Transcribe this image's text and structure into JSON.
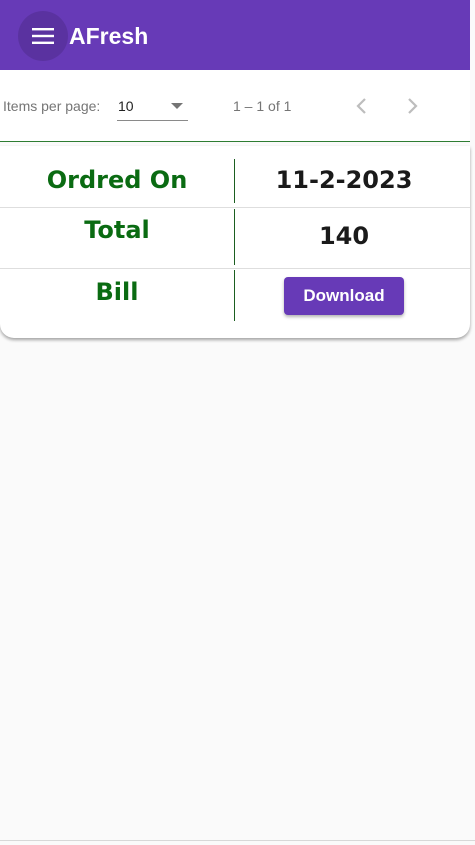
{
  "toolbar": {
    "app_title": "AFresh",
    "menu_icon": "menu-icon",
    "color": "#673ab7"
  },
  "paginator": {
    "items_per_page_label": "Items per page:",
    "page_size": "10",
    "range_label": "1 – 1 of 1",
    "prev_icon": "chevron-left-icon",
    "next_icon": "chevron-right-icon"
  },
  "order": {
    "rows": [
      {
        "label": "Ordred On",
        "value": "11-2-2023"
      },
      {
        "label": "Total",
        "value": "140"
      },
      {
        "label": "Bill",
        "button": "Download"
      }
    ],
    "label_color": "#0a6b12"
  }
}
